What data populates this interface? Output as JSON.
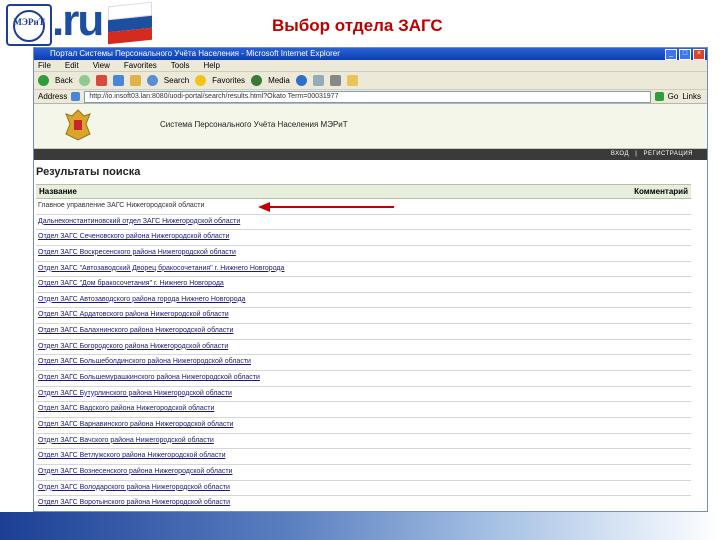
{
  "slide": {
    "logo_text": "МЭРиТ",
    "brand_text": ".ru",
    "title": "Выбор отдела ЗАГС",
    "flag_colors": [
      "#ffffff",
      "#1c4fa0",
      "#d52b1e"
    ],
    "accent": "#c00000"
  },
  "browser": {
    "window_title": "Портал Системы Персонального Учёта Населения - Microsoft Internet Explorer",
    "menu": [
      "File",
      "Edit",
      "View",
      "Favorites",
      "Tools",
      "Help"
    ],
    "toolbar": {
      "back_label": "Back",
      "search_label": "Search",
      "favorites_label": "Favorites",
      "media_label": "Media"
    },
    "address_label": "Address",
    "address_url": "http://io.insoft03.lan:8080/uodi-portal/search/results.html?Okato Term=00031977",
    "go_label": "Go",
    "links_label": "Links"
  },
  "site": {
    "header_title": "Система Персонального Учёта Населения МЭРиТ",
    "nav_login": "ВХОД",
    "nav_sep": "|",
    "nav_register": "РЕГИСТРАЦИЯ"
  },
  "results": {
    "title": "Результаты поиска",
    "col_name": "Название",
    "col_comment": "Комментарий",
    "rows": [
      "Главное управление ЗАГС Нижегородской области",
      "Дальнеконстантиновский отдел ЗАГС Нижегородской области",
      "Отдел ЗАГС Сеченовского района Нижегородской области",
      "Отдел ЗАГС Воскресенского района Нижегородской области",
      "Отдел ЗАГС \"Автозаводский Дворец бракосочетания\" г. Нижнего Новгорода",
      "Отдел ЗАГС \"Дом бракосочетания\" г. Нижнего Новгорода",
      "Отдел ЗАГС Автозаводского района города Нижнего Новгорода",
      "Отдел ЗАГС Ардатовского района Нижегородской области",
      "Отдел ЗАГС Балахнинского района Нижегородской области",
      "Отдел ЗАГС Богородского района Нижегородской области",
      "Отдел ЗАГС Большеболдинского района Нижегородской области",
      "Отдел ЗАГС Большемурашкинского района Нижегородской области",
      "Отдел ЗАГС Бутурлинского района Нижегородской области",
      "Отдел ЗАГС Вадского района Нижегородской области",
      "Отдел ЗАГС Варнавинского района Нижегородской области",
      "Отдел ЗАГС Вачского района Нижегородской области",
      "Отдел ЗАГС Ветлужского района Нижегородской области",
      "Отдел ЗАГС Вознесенского района Нижегородской области",
      "Отдел ЗАГС Володарского района Нижегородской области",
      "Отдел ЗАГС Воротынского района Нижегородской области"
    ]
  }
}
